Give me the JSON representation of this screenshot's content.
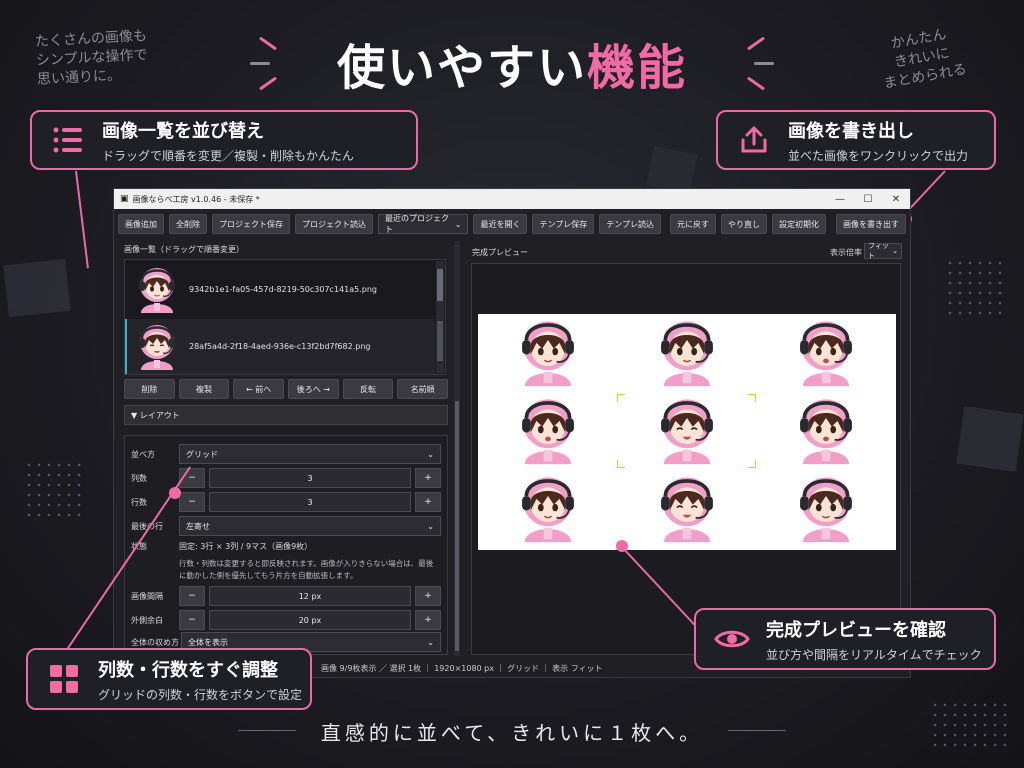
{
  "hero": {
    "part1": "使いやすい",
    "part2": "機能"
  },
  "notes": {
    "left": [
      "たくさんの画像も",
      "シンプルな操作で",
      "思い通りに。"
    ],
    "right": [
      "かんたん",
      "きれいに",
      "まとめられる"
    ]
  },
  "callouts": {
    "sort": {
      "title": "画像一覧を並び替え",
      "desc": "ドラッグで順番を変更／複製・削除もかんたん",
      "icon": "list-icon"
    },
    "export": {
      "title": "画像を書き出し",
      "desc": "並べた画像をワンクリックで出力",
      "icon": "export-icon"
    },
    "grid": {
      "title": "列数・行数をすぐ調整",
      "desc": "グリッドの列数・行数をボタンで設定",
      "icon": "grid-icon"
    },
    "preview": {
      "title": "完成プレビューを確認",
      "desc": "並び方や間隔をリアルタイムでチェック",
      "icon": "eye-icon"
    }
  },
  "tagline": "直感的に並べて、きれいに１枚へ。",
  "app": {
    "title": "画像ならべ工房 v1.0.46 - 未保存 *",
    "window_controls": {
      "minimize": "—",
      "maximize": "☐",
      "close": "✕"
    },
    "toolbar": {
      "add": "画像追加",
      "delete_all": "全削除",
      "save_project": "プロジェクト保存",
      "load_project": "プロジェクト読込",
      "recent": "最近のプロジェクト",
      "open_recent": "最近を開く",
      "save_template": "テンプレ保存",
      "load_template": "テンプレ読込",
      "undo": "元に戻す",
      "redo": "やり直し",
      "reset": "設定初期化",
      "export": "画像を書き出す"
    },
    "list_label": "画像一覧（ドラッグで順番変更）",
    "images": [
      {
        "name": "9342b1e1-fa05-457d-8219-50c307c141a5.png"
      },
      {
        "name": "28af5a4d-2f18-4aed-936e-c13f2bd7f682.png"
      }
    ],
    "list_buttons": {
      "delete": "削除",
      "duplicate": "複製",
      "prev": "← 前へ",
      "next": "後ろへ →",
      "reverse": "反転",
      "by_name": "名前順"
    },
    "layout_section": "▼ レイアウト",
    "settings": {
      "arrange_label": "並べ方",
      "arrange_value": "グリッド",
      "columns_label": "列数",
      "columns_value": "3",
      "rows_label": "行数",
      "rows_value": "3",
      "last_row_label": "最後の行",
      "last_row_value": "左寄せ",
      "state_label": "状態",
      "state_value": "固定: 3行 × 3列 / 9マス（画像9枚）",
      "note": "行数・列数は変更すると即反映されます。画像が入りきらない場合は、最後に動かした側を優先してもう片方を自動拡張します。",
      "spacing_label": "画像間隔",
      "spacing_value": "12 px",
      "margin_label": "外側余白",
      "margin_value": "20 px",
      "fit_label": "全体の収め方",
      "fit_value": "全体を表示",
      "minus": "−",
      "plus": "+"
    },
    "preview": {
      "label": "完成プレビュー",
      "zoom_label": "表示倍率",
      "zoom_value": "フィット"
    },
    "status": "画像 9/9枚表示 ／ 選択 1枚 ｜ 1920×1080 px ｜ グリッド ｜ 表示 フィット"
  },
  "colors": {
    "accent": "#f06aa6",
    "hoodie": "#f0a0c8",
    "hair": "#4a2a1e"
  }
}
